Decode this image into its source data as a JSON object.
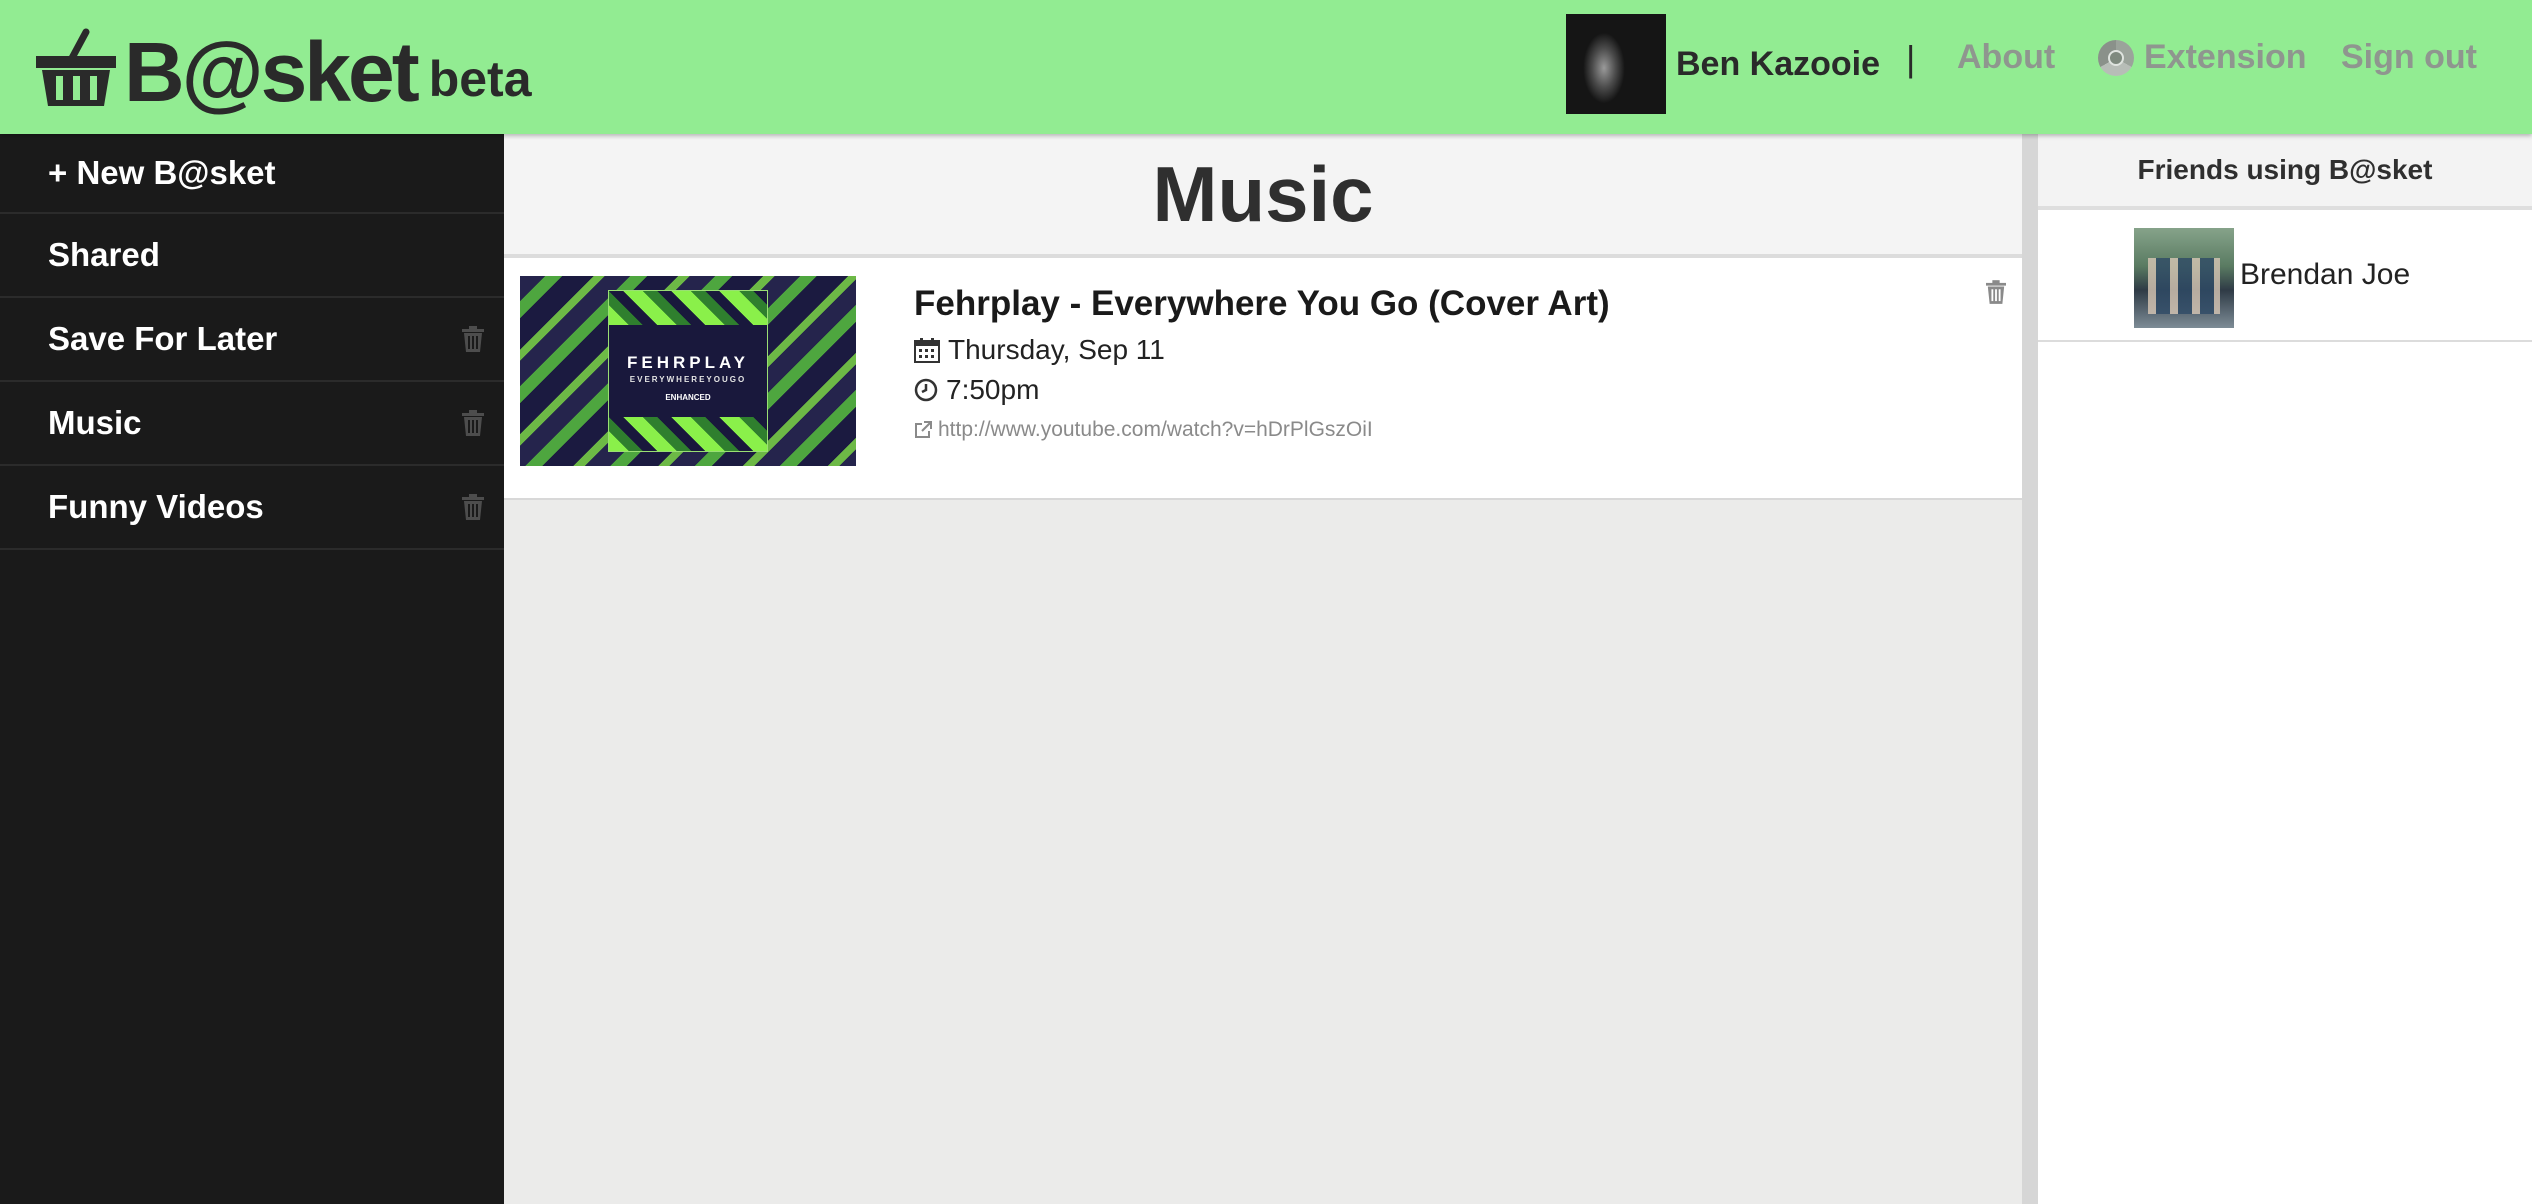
{
  "header": {
    "logo_text": "B@sket",
    "beta_label": "beta",
    "user_name": "Ben Kazooie",
    "separator": "|",
    "nav": {
      "about": "About",
      "extension": "Extension",
      "sign_out": "Sign out"
    }
  },
  "sidebar": {
    "items": [
      {
        "label": "+ New B@sket"
      },
      {
        "label": "Shared"
      },
      {
        "label": "Save For Later"
      },
      {
        "label": "Music"
      },
      {
        "label": "Funny Videos"
      }
    ]
  },
  "main": {
    "title": "Music",
    "items": [
      {
        "title": "Fehrplay - Everywhere You Go (Cover Art)",
        "date": "Thursday, Sep 11",
        "time": "7:50pm",
        "url": "http://www.youtube.com/watch?v=hDrPlGszOiI",
        "thumb_text_1": "FEHRPLAY",
        "thumb_text_2": "EVERYWHEREYOUGO",
        "thumb_text_3": "ENHANCED"
      }
    ]
  },
  "friends": {
    "title": "Friends using B@sket",
    "list": [
      {
        "name": "Brendan Joe"
      }
    ]
  },
  "colors": {
    "header_bg": "#92ec92",
    "sidebar_bg": "#1a1a1a",
    "nav_link": "#8f968f"
  }
}
